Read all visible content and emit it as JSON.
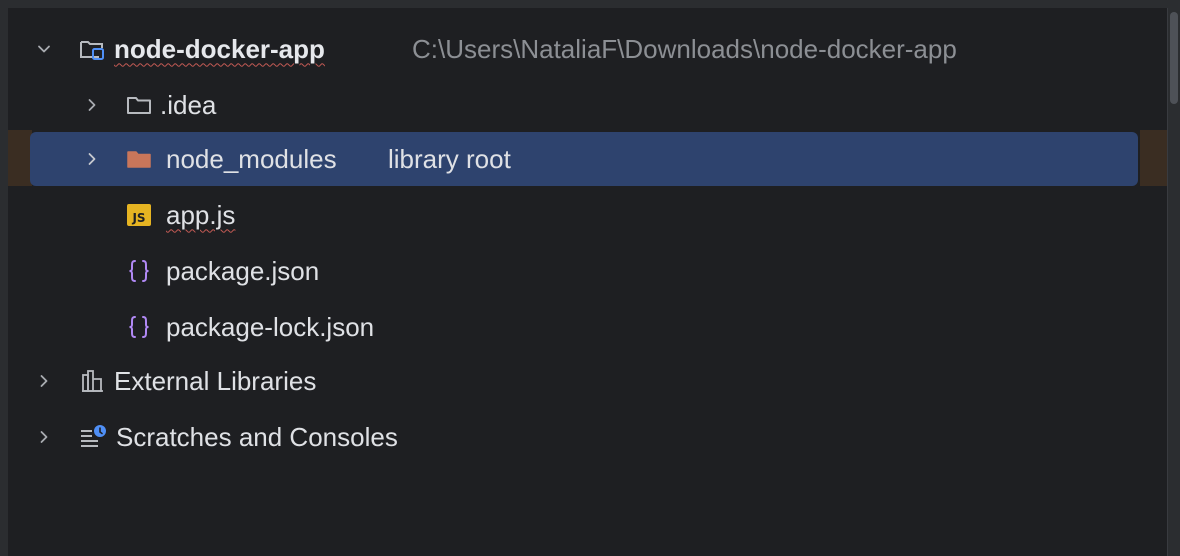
{
  "project_tree": {
    "root": {
      "name": "node-docker-app",
      "path": "C:\\Users\\NataliaF\\Downloads\\node-docker-app",
      "expanded": true
    },
    "items": [
      {
        "name": ".idea",
        "type": "folder",
        "expandable": true
      },
      {
        "name": "node_modules",
        "hint": "library root",
        "type": "folder",
        "expandable": true,
        "selected": true
      },
      {
        "name": "app.js",
        "type": "javascript-file",
        "icon_text": "JS"
      },
      {
        "name": "package.json",
        "type": "json-file"
      },
      {
        "name": "package-lock.json",
        "type": "json-file"
      }
    ],
    "external_libraries": {
      "label": "External Libraries"
    },
    "scratches": {
      "label": "Scratches and Consoles"
    }
  },
  "colors": {
    "background": "#1e1f22",
    "selection": "#2e436e",
    "folder_excluded": "#c9765a",
    "json_icon": "#b189f5",
    "js_badge": "#e6b422",
    "muted_text": "#8c8f94"
  }
}
